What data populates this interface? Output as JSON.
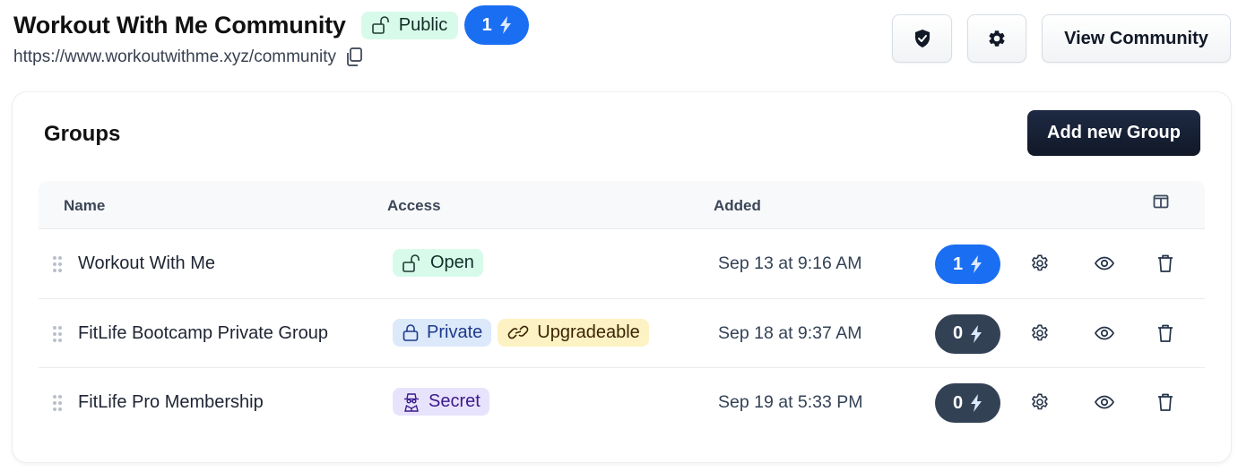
{
  "header": {
    "title": "Workout With Me Community",
    "visibility_badge": {
      "label": "Public",
      "icon": "lock-open-icon"
    },
    "bolt_count": "1",
    "url": "https://www.workoutwithme.xyz/community",
    "buttons": {
      "shield_icon": "shield-check-icon",
      "settings_icon": "gear-icon",
      "view_label": "View Community"
    }
  },
  "groups": {
    "title": "Groups",
    "add_button_label": "Add new Group",
    "columns": {
      "name": "Name",
      "access": "Access",
      "added": "Added"
    },
    "rows": [
      {
        "name": "Workout With Me",
        "access": [
          {
            "label": "Open",
            "icon": "lock-open-icon",
            "kind": "open"
          }
        ],
        "added": "Sep 13 at 9:16 AM",
        "bolt_count": "1",
        "bolt_style": "blue"
      },
      {
        "name": "FitLife Bootcamp Private Group",
        "access": [
          {
            "label": "Private",
            "icon": "lock-closed-icon",
            "kind": "private"
          },
          {
            "label": "Upgradeable",
            "icon": "link-icon",
            "kind": "upgradeable"
          }
        ],
        "added": "Sep 18 at 9:37 AM",
        "bolt_count": "0",
        "bolt_style": "dark"
      },
      {
        "name": "FitLife Pro Membership",
        "access": [
          {
            "label": "Secret",
            "icon": "spy-icon",
            "kind": "secret"
          }
        ],
        "added": "Sep 19 at 5:33 PM",
        "bolt_count": "0",
        "bolt_style": "dark"
      }
    ]
  },
  "colors": {
    "accent_blue": "#1a6ef2",
    "dark_pill": "#334155",
    "primary_button": "#111827",
    "open_badge": "#d8faea",
    "private_badge": "#dce9fb",
    "upgradeable_badge": "#fdf2c3",
    "secret_badge": "#e8e3fc"
  }
}
